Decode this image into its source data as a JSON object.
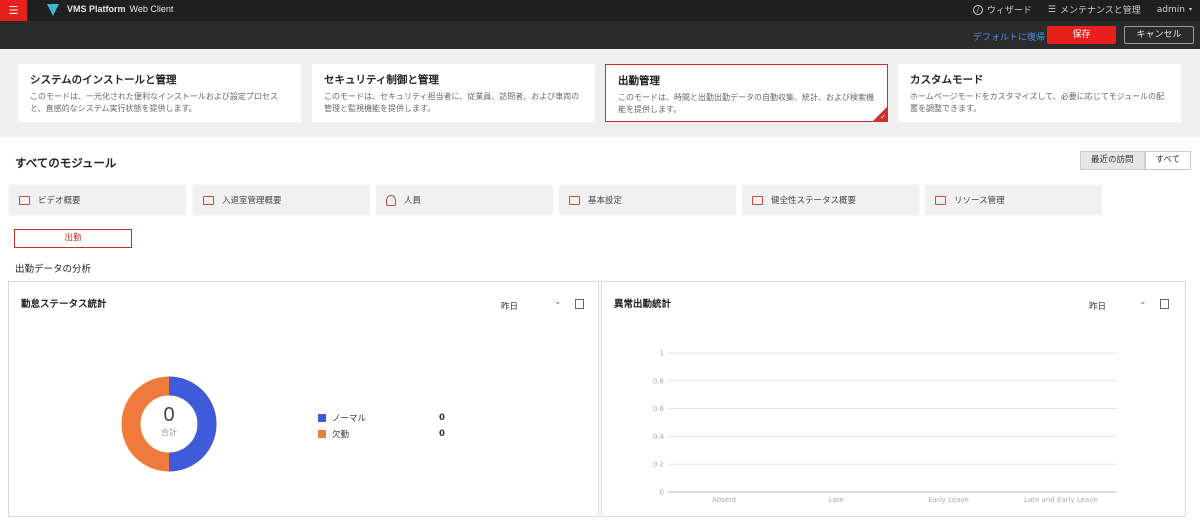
{
  "topbar": {
    "menu_icon": "hamburger-icon",
    "logo_icon": "vms-logo-icon",
    "app_name": "VMS Platform",
    "app_sub": "Web Client",
    "wizard_label": "ウィザード",
    "maintenance_label": "メンテナンスと管理",
    "user_label": "admin",
    "menu_bg": "#e8201c"
  },
  "actions": {
    "default_link": "デフォルトに復帰",
    "save_label": "保存",
    "cancel_label": "キャンセル"
  },
  "modes": [
    {
      "title": "システムのインストールと管理",
      "desc": "このモードは、一元化された便利なインストールおよび設定プロセスと、直感的なシステム実行状態を提供します。",
      "selected": false
    },
    {
      "title": "セキュリティ制御と管理",
      "desc": "このモードは、セキュリティ担当者に、従業員、訪問者、および車両の管理と監視機能を提供します。",
      "selected": false
    },
    {
      "title": "出勤管理",
      "desc": "このモードは、時間と出勤出勤データの自動収集、統計、および検索機能を提供します。",
      "selected": true
    },
    {
      "title": "カスタムモード",
      "desc": "ホームページモードをカスタマイズして、必要に応じてモジュールの配置を調整できます。",
      "selected": false
    }
  ],
  "modules_section": {
    "title": "すべてのモジュール",
    "toggle_recent": "最近の訪問",
    "toggle_all": "すべて"
  },
  "modules": [
    {
      "label": "ビデオ概要",
      "icon": "video-icon"
    },
    {
      "label": "入退室管理概要",
      "icon": "access-control-icon"
    },
    {
      "label": "人員",
      "icon": "person-icon"
    },
    {
      "label": "基本設定",
      "icon": "settings-icon"
    },
    {
      "label": "健全性ステータス概要",
      "icon": "health-icon"
    },
    {
      "label": "リソース管理",
      "icon": "resource-icon"
    }
  ],
  "active_tab": "出勤",
  "analysis_title": "出勤データの分析",
  "status_panel": {
    "title": "勤怠ステータス統計",
    "period": "昨日",
    "total_value": "0",
    "total_label": "合計",
    "legend": [
      {
        "label": "ノーマル",
        "value": "0",
        "color": "#3f5bdc"
      },
      {
        "label": "欠勤",
        "value": "0",
        "color": "#f07a3c"
      }
    ]
  },
  "abnormal_panel": {
    "title": "異常出勤統計",
    "period": "昨日"
  },
  "chart_data": {
    "type": "bar",
    "categories": [
      "Absent",
      "Late",
      "Early Leave",
      "Late and Early Leave"
    ],
    "values": [
      0,
      0,
      0,
      0
    ],
    "y_ticks": [
      "0",
      "0.2",
      "0.4",
      "0.6",
      "0.8",
      "1"
    ],
    "ylim": [
      0,
      1
    ],
    "grid": true
  }
}
